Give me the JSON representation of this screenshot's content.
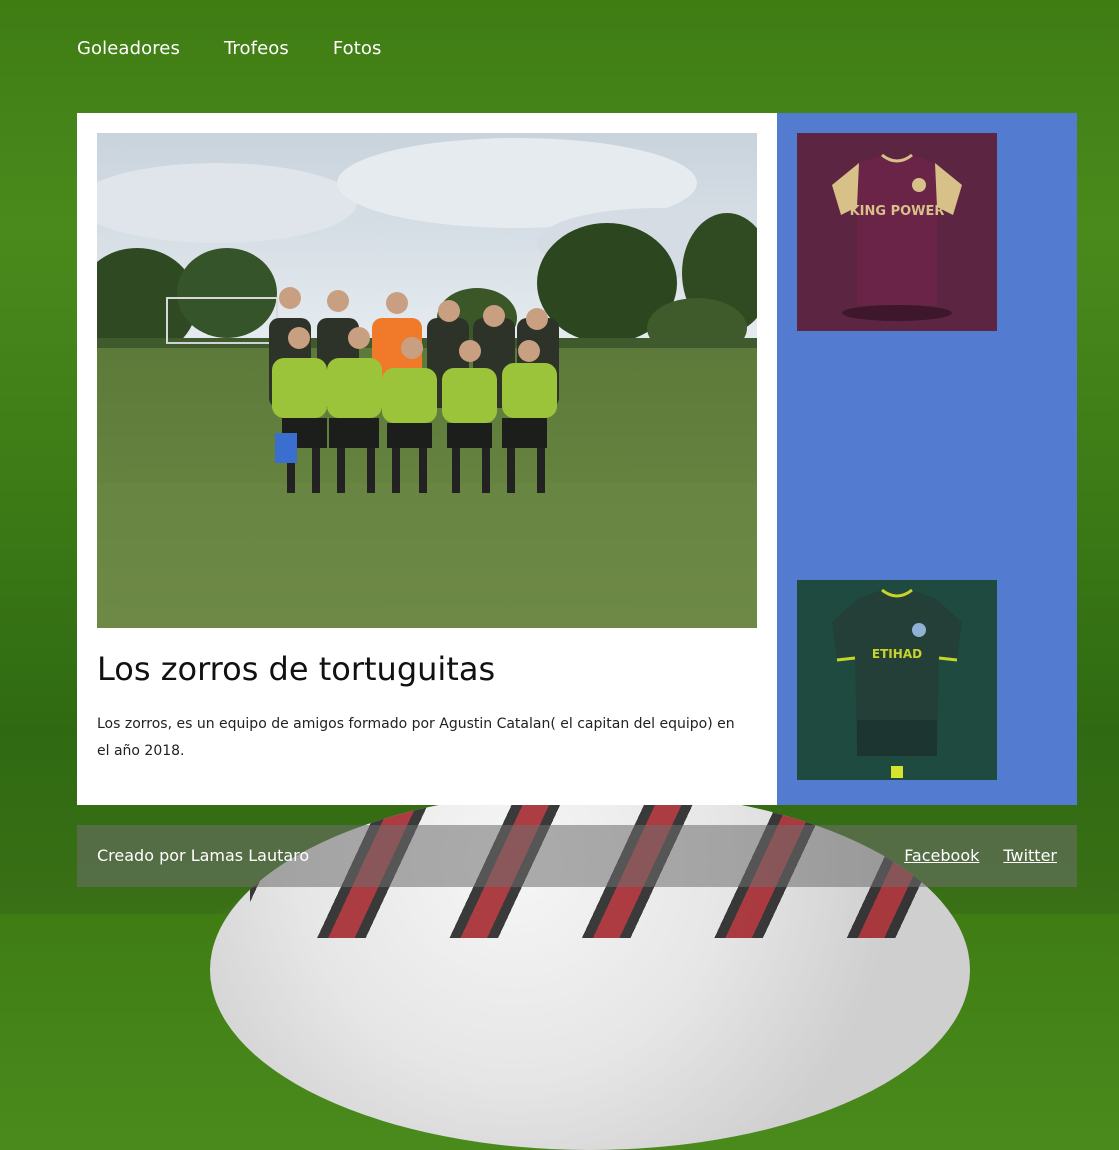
{
  "nav": {
    "items": [
      {
        "label": "Goleadores"
      },
      {
        "label": "Trofeos"
      },
      {
        "label": "Fotos"
      }
    ]
  },
  "main": {
    "title": "Los zorros de tortuguitas",
    "description": "Los zorros, es un equipo de amigos formado por Agustin Catalan( el capitan del equipo) en el año 2018."
  },
  "sidebar": {
    "jerseys": [
      {
        "sponsor": "KING POWER",
        "color": "#5c2542"
      },
      {
        "sponsor": "ETIHAD",
        "color": "#1f4a3f"
      }
    ]
  },
  "footer": {
    "credit": "Creado por Lamas Lautaro",
    "links": [
      {
        "label": "Facebook"
      },
      {
        "label": "Twitter"
      }
    ]
  },
  "colors": {
    "sidebar_bg": "#537bcf",
    "main_bg": "#ffffff",
    "page_bg": "#3f7d14"
  }
}
